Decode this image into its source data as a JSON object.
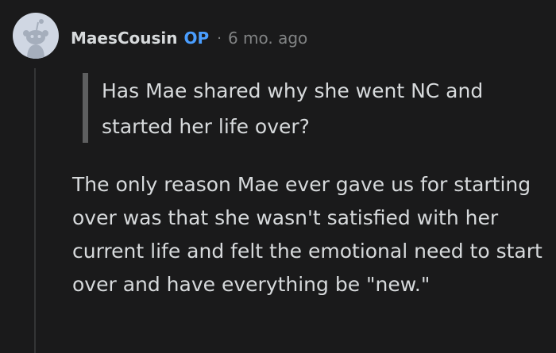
{
  "comment": {
    "author": "MaesCousin",
    "op_badge": "OP",
    "separator": "·",
    "timestamp": "6 mo. ago",
    "quote": "Has Mae shared why she went NC and started her life over?",
    "body": "The only reason Mae ever gave us for starting over was that she wasn't satisfied with her current life and felt the emotional need to start over and have everything be \"new.\""
  },
  "icons": {
    "avatar": "snoo-avatar-icon"
  },
  "colors": {
    "background": "#1a1a1b",
    "text": "#d7dadc",
    "op_badge": "#4a9eff",
    "muted": "#818384",
    "avatar_bg": "#d0d7e3",
    "snoo": "#a5aebc"
  }
}
